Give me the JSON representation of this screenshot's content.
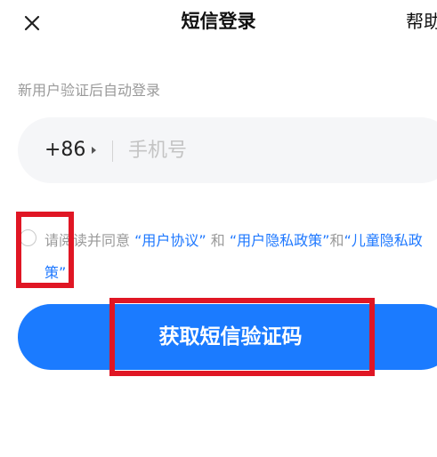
{
  "header": {
    "title": "短信登录",
    "help_label": "帮助",
    "close_icon": "close-icon"
  },
  "hint": "新用户验证后自动登录",
  "phone": {
    "country_code": "+86",
    "caret_icon": "caret-right-icon",
    "placeholder": "手机号",
    "value": ""
  },
  "agreement": {
    "text_prefix": "请阅读并同意 ",
    "user_agreement": "“用户协议”",
    "and_1": " 和 ",
    "privacy_policy": "“用户隐私政策”",
    "and_2": "和",
    "children_policy": "“儿童隐私政策”",
    "checked": false
  },
  "primary_button": {
    "label": "获取短信验证码"
  },
  "colors": {
    "accent": "#1b7bff",
    "link": "#1e78ff",
    "annotation_red": "#e01624"
  }
}
